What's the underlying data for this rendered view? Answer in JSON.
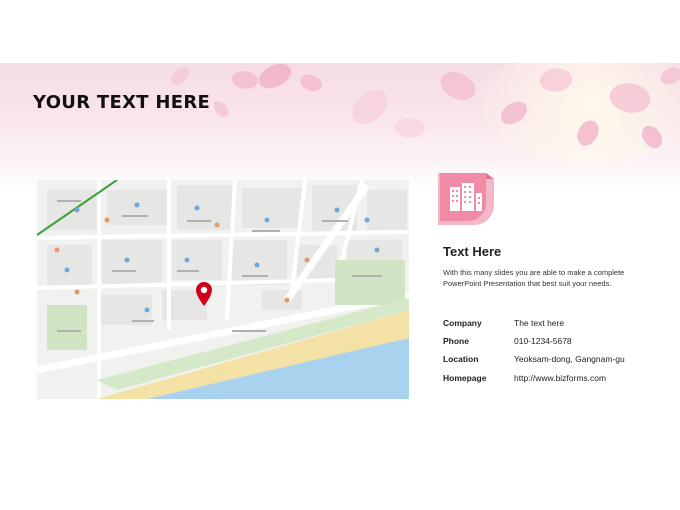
{
  "slide": {
    "title": "YOUR TEXT HERE"
  },
  "banner": {
    "image": "pink-flower-petals-background"
  },
  "map": {
    "image": "street-map",
    "marker_icon": "location-pin-icon",
    "colors": {
      "sea": "#a8d2ee",
      "beach": "#f3e1a6",
      "park": "#cfe4c2",
      "marker": "#d0021b"
    }
  },
  "card": {
    "icon": "building-icon",
    "accent_color": "#f08aa6",
    "heading": "Text Here",
    "description": "With this many slides you are able to make a complete PowerPoint Presentation that best suit your needs.",
    "rows": [
      {
        "label": "Company",
        "value": "The text here"
      },
      {
        "label": "Phone",
        "value": "010-1234-5678"
      },
      {
        "label": "Location",
        "value": "Yeoksam-dong, Gangnam-gu"
      },
      {
        "label": "Homepage",
        "value": "http://www.bizforms.com"
      }
    ]
  }
}
